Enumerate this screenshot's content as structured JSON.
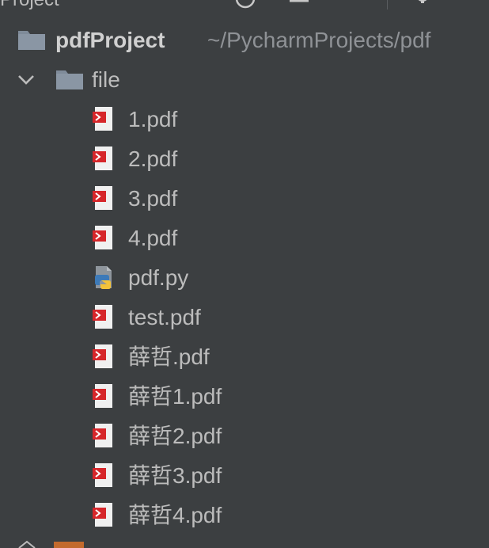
{
  "toolbar": {
    "title": "Project",
    "icons": [
      "target-icon",
      "collapse-all-icon",
      "expand-icon",
      "gear-icon"
    ]
  },
  "tree": {
    "root": {
      "name": "pdfProject",
      "path": "~/PycharmProjects/pdf"
    },
    "folder": {
      "name": "file",
      "expanded": true
    },
    "files": [
      {
        "name": "1.pdf",
        "type": "pdf"
      },
      {
        "name": "2.pdf",
        "type": "pdf"
      },
      {
        "name": "3.pdf",
        "type": "pdf"
      },
      {
        "name": "4.pdf",
        "type": "pdf"
      },
      {
        "name": "pdf.py",
        "type": "python"
      },
      {
        "name": "test.pdf",
        "type": "pdf"
      },
      {
        "name": "薛哲.pdf",
        "type": "pdf"
      },
      {
        "name": "薛哲1.pdf",
        "type": "pdf"
      },
      {
        "name": "薛哲2.pdf",
        "type": "pdf"
      },
      {
        "name": "薛哲3.pdf",
        "type": "pdf"
      },
      {
        "name": "薛哲4.pdf",
        "type": "pdf"
      }
    ]
  },
  "colors": {
    "background": "#3c3f41",
    "text": "#bcbcbc",
    "path_text": "#8f9296",
    "folder": "#7f8b99",
    "pdf_red": "#d6262a",
    "python_blue": "#3d7ab8",
    "python_yellow": "#f2c23a"
  }
}
